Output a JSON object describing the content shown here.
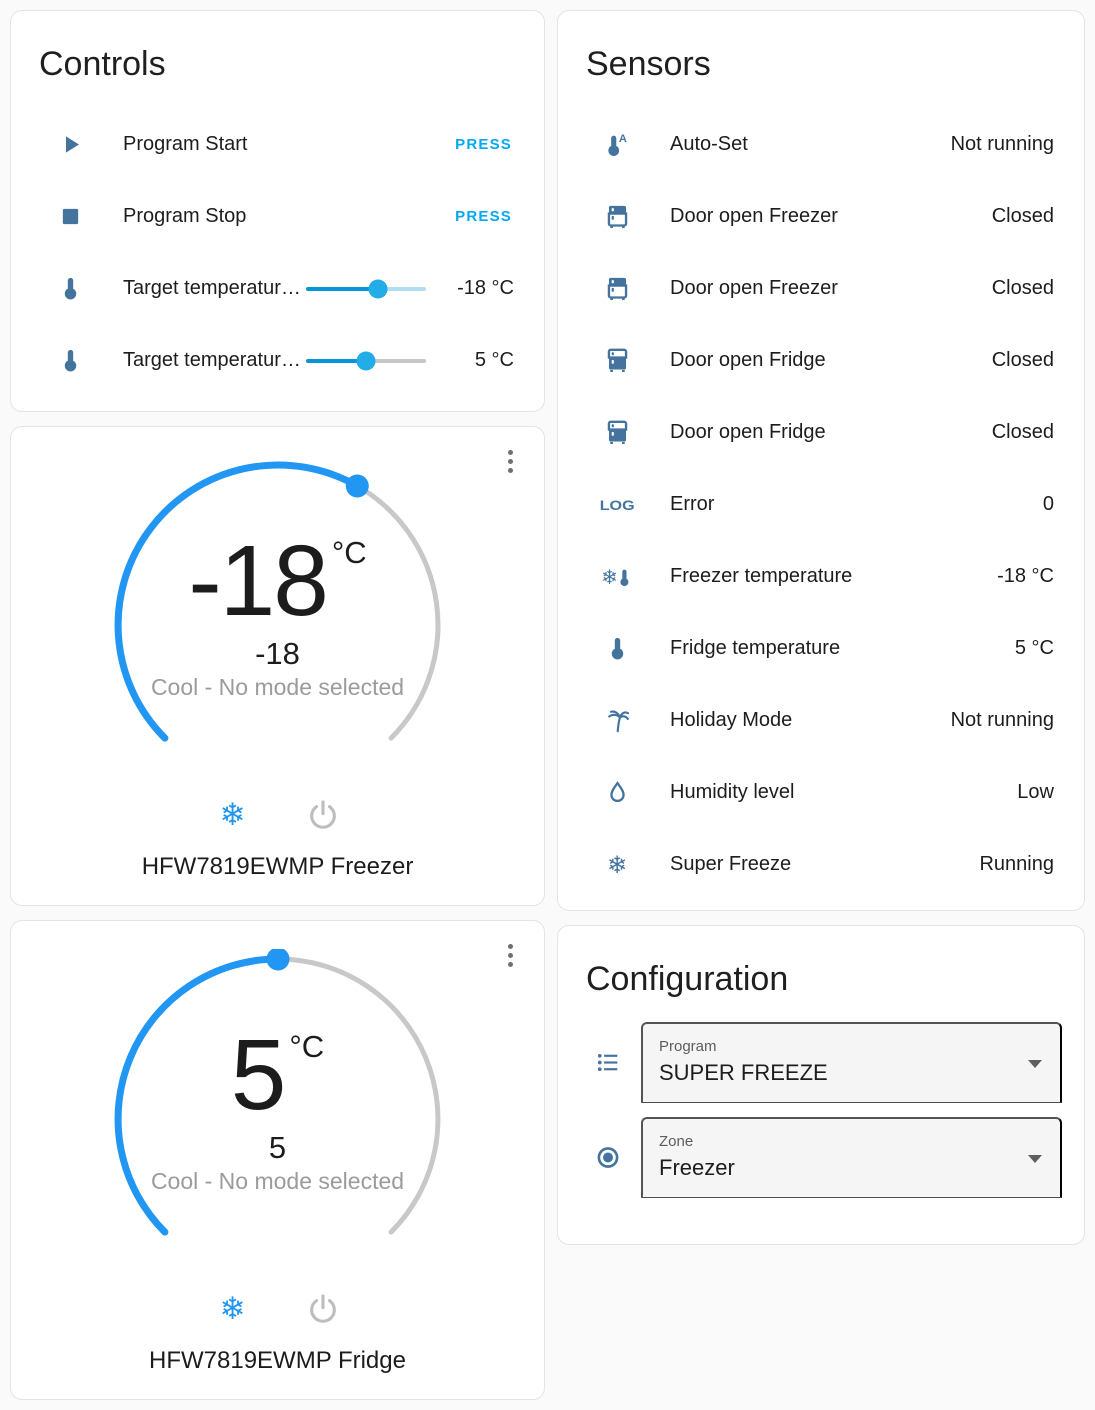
{
  "colors": {
    "icon_blue": "#44739e",
    "accent_blue": "#03a9f4",
    "dial_blue": "#2196f3",
    "dial_gray": "#c8c8c8",
    "page_bg": "#fafafa"
  },
  "controls": {
    "title": "Controls",
    "rows": [
      {
        "icon": "play-icon",
        "label": "Program Start",
        "type": "press",
        "action": "PRESS"
      },
      {
        "icon": "stop-icon",
        "label": "Program Stop",
        "type": "press",
        "action": "PRESS"
      },
      {
        "icon": "thermometer-icon",
        "label": "Target temperatur…",
        "type": "slider",
        "value": "-18 °C",
        "fraction": 0.6,
        "inactive_color": "#b3dcf5"
      },
      {
        "icon": "thermometer-icon",
        "label": "Target temperatur…",
        "type": "slider",
        "value": "5 °C",
        "fraction": 0.5,
        "inactive_color": "#c6c6c6"
      }
    ]
  },
  "thermostats": [
    {
      "value": "-18",
      "unit": "°C",
      "secondary": "-18",
      "status": "Cool - No mode selected",
      "name": "HFW7819EWMP Freezer",
      "arc_fraction": 0.61
    },
    {
      "value": "5",
      "unit": "°C",
      "secondary": "5",
      "status": "Cool - No mode selected",
      "name": "HFW7819EWMP Fridge",
      "arc_fraction": 0.5
    }
  ],
  "sensors": {
    "title": "Sensors",
    "rows": [
      {
        "icon": "thermometer-auto-icon",
        "label": "Auto-Set",
        "value": "Not running"
      },
      {
        "icon": "fridge-bottom-icon",
        "label": "Door open Freezer",
        "value": "Closed"
      },
      {
        "icon": "fridge-bottom-icon",
        "label": "Door open Freezer",
        "value": "Closed"
      },
      {
        "icon": "fridge-top-icon",
        "label": "Door open Fridge",
        "value": "Closed"
      },
      {
        "icon": "fridge-top-icon",
        "label": "Door open Fridge",
        "value": "Closed"
      },
      {
        "icon": "log-icon",
        "label": "Error",
        "value": "0"
      },
      {
        "icon": "snowflake-thermometer-icon",
        "label": "Freezer temperature",
        "value": "-18 °C"
      },
      {
        "icon": "thermometer-icon",
        "label": "Fridge temperature",
        "value": "5 °C"
      },
      {
        "icon": "palm-tree-icon",
        "label": "Holiday Mode",
        "value": "Not running"
      },
      {
        "icon": "water-drop-icon",
        "label": "Humidity level",
        "value": "Low"
      },
      {
        "icon": "snowflake-icon",
        "label": "Super Freeze",
        "value": "Running"
      }
    ]
  },
  "configuration": {
    "title": "Configuration",
    "fields": [
      {
        "icon": "list-icon",
        "label": "Program",
        "value": "SUPER FREEZE"
      },
      {
        "icon": "radio-selected-icon",
        "label": "Zone",
        "value": "Freezer"
      }
    ]
  },
  "icons": {
    "snowflake_glyph": "❄",
    "log_glyph": "LOG",
    "auto_letter": "A"
  }
}
